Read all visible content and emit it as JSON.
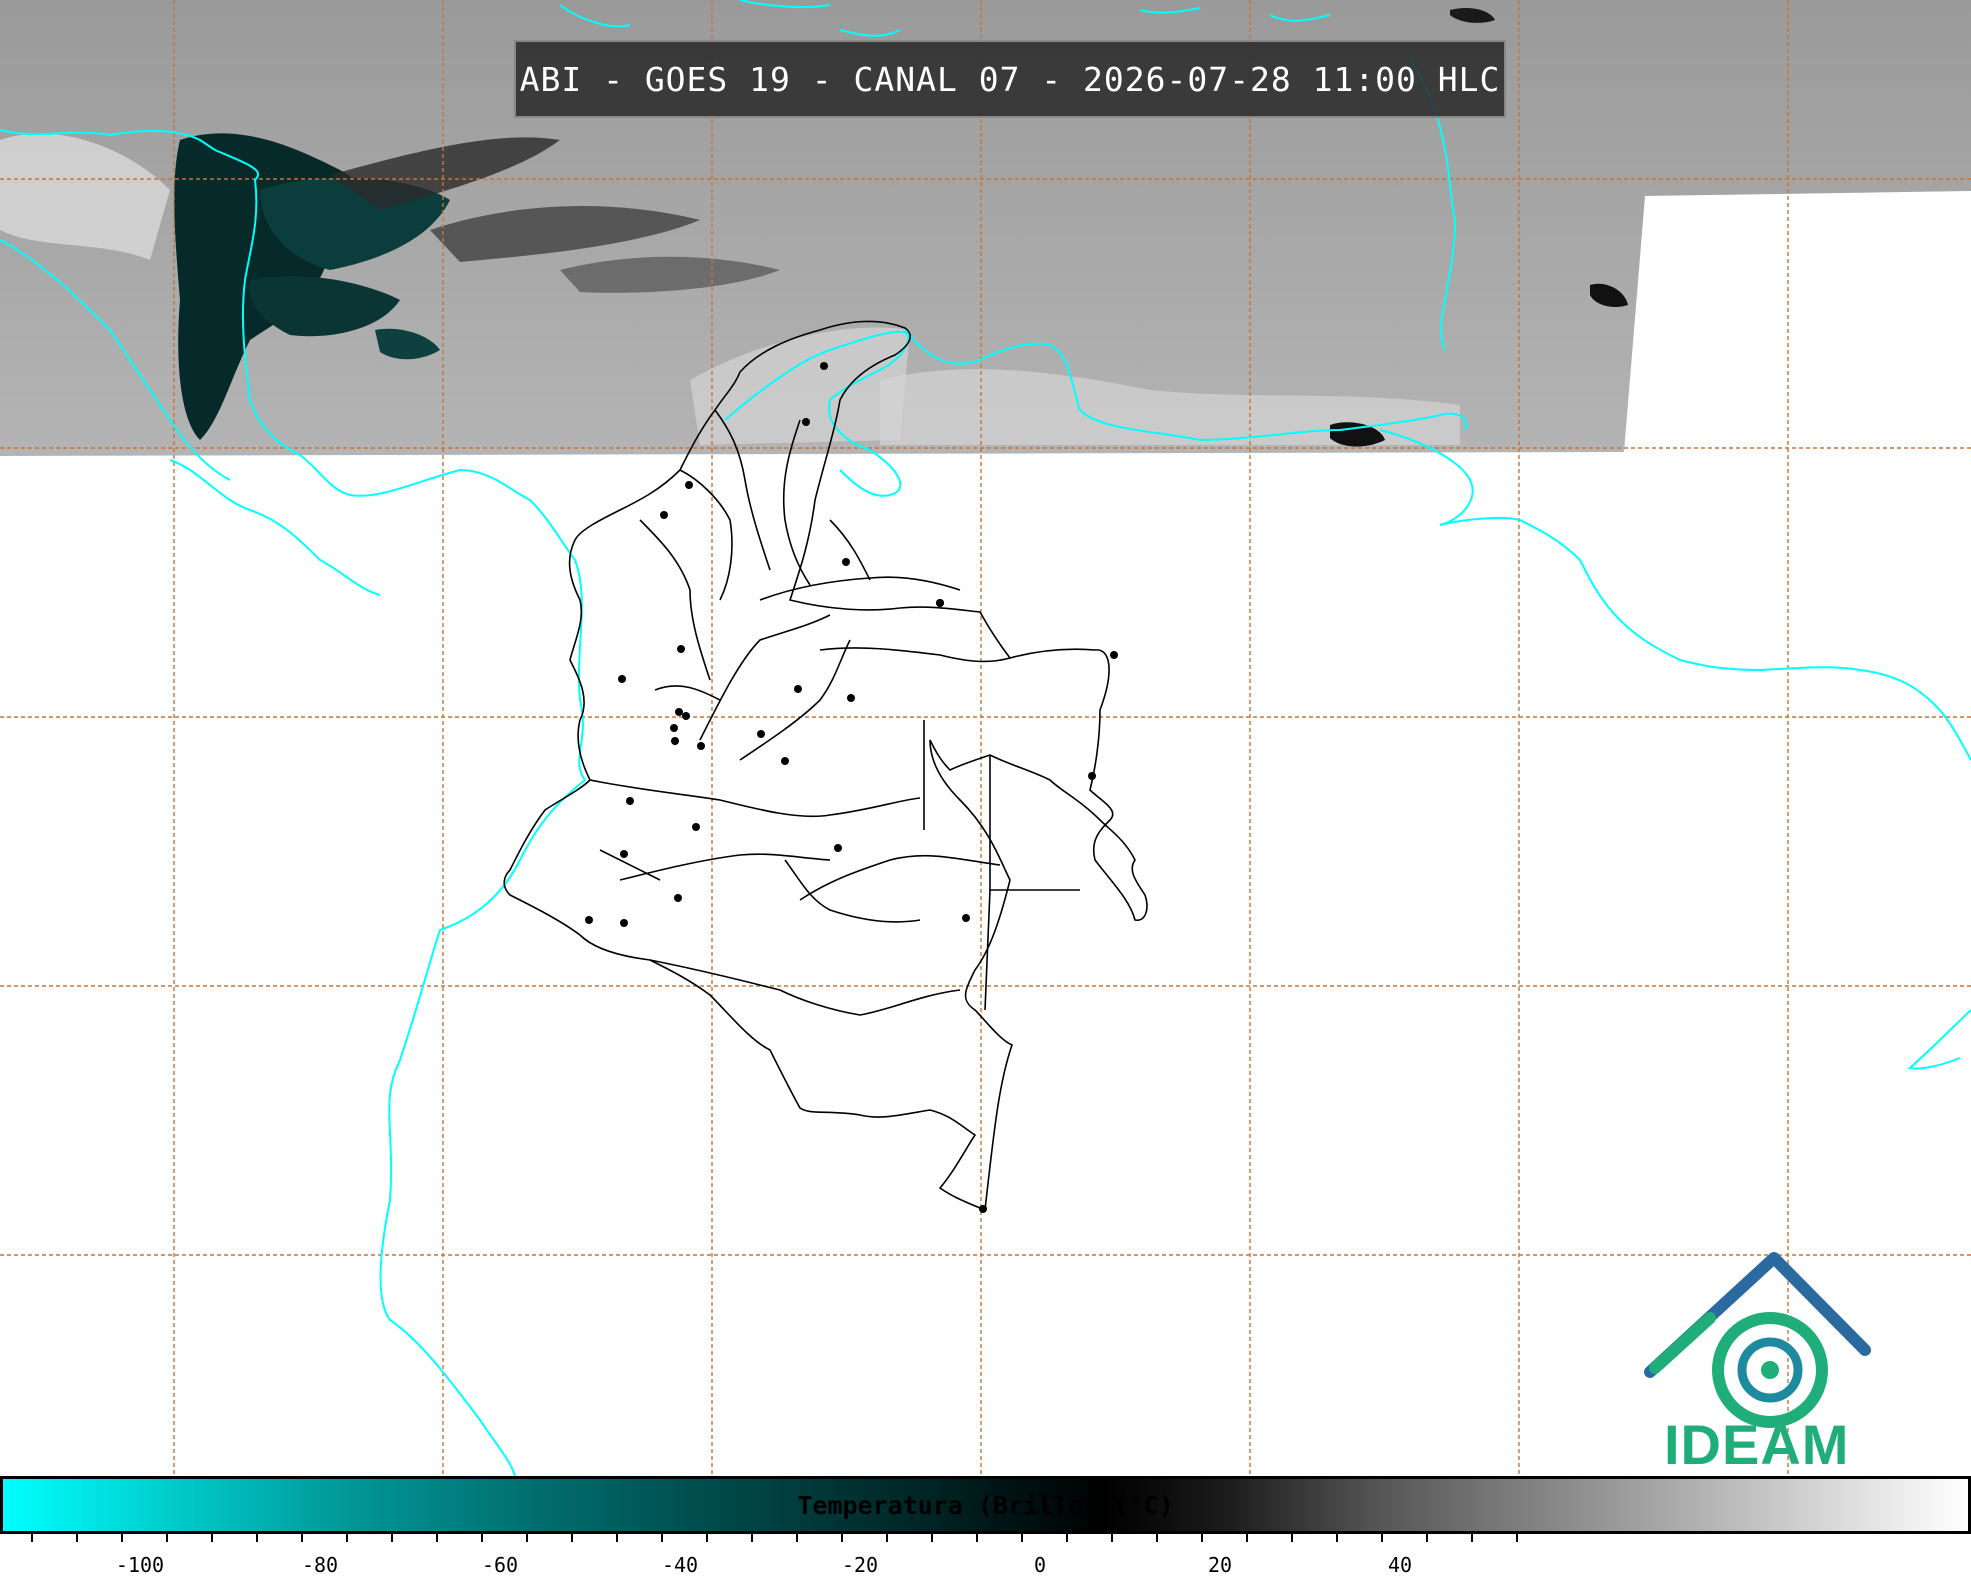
{
  "title": "ABI - GOES 19 - CANAL 07 - 2026-07-28 11:00 HLC",
  "logo": {
    "text": "IDEAM",
    "color": "#1fae7a",
    "accent": "#2a5d9a"
  },
  "colorbar": {
    "label": "Temperatura (Brillo) (°C)",
    "ticks": [
      {
        "value": -100,
        "label": "-100"
      },
      {
        "value": -80,
        "label": "-80"
      },
      {
        "value": -60,
        "label": "-60"
      },
      {
        "value": -40,
        "label": "-40"
      },
      {
        "value": -20,
        "label": "-20"
      },
      {
        "value": 0,
        "label": "0"
      },
      {
        "value": 20,
        "label": "20"
      },
      {
        "value": 40,
        "label": "40"
      }
    ],
    "range": [
      -112,
      56
    ],
    "colors": {
      "cold": "#00ffff",
      "mid": "#000000",
      "warm": "#ffffff"
    }
  },
  "map": {
    "coastline_color": "#00ffff",
    "grid_color": "#c87533",
    "border_color": "#000000",
    "satellite_coverage": "partial (northern strip only)"
  }
}
